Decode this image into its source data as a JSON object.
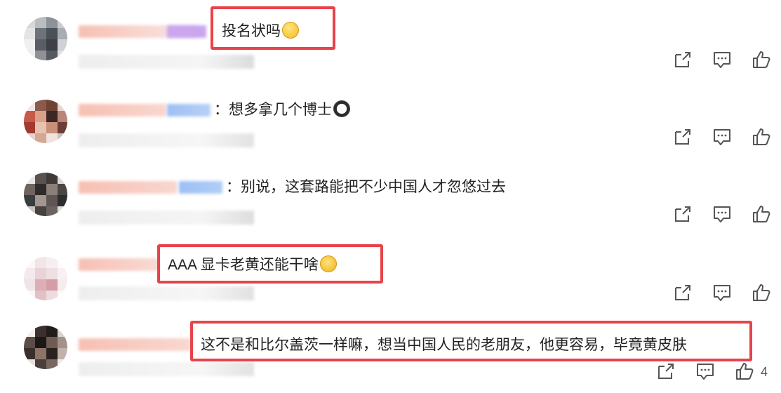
{
  "comments": [
    {
      "text": "投名状吗",
      "emoji": "smile-emoji",
      "colors": [
        "#cfd2d6",
        "#e9eaec",
        "#9aa0a6",
        "#5b5f66"
      ]
    },
    {
      "text": "：想多拿几个博士",
      "emoji": "panda-emoji",
      "colors": [
        "#c86a5d",
        "#7a4a3a",
        "#d9b4a2",
        "#3b2b29"
      ]
    },
    {
      "text": "：别说，这套路能把不少中国人才忽悠过去",
      "emoji": "",
      "colors": [
        "#4a4b4d",
        "#7c6f68",
        "#2e3133",
        "#a7a09a"
      ]
    },
    {
      "text": "AAA 显卡老黄还能干啥",
      "emoji": "thinking-emoji",
      "colors": [
        "#f4e8ea",
        "#e6d0d4",
        "#d8a9b0",
        "#ffffff"
      ]
    },
    {
      "text": "这不是和比尔盖茨一样嘛，想当中国人民的老朋友，他更容易，毕竟黄皮肤",
      "emoji": "",
      "colors": [
        "#3a2d2a",
        "#6c5a53",
        "#1e1a19",
        "#b7a49a"
      ],
      "like_count": "4"
    }
  ],
  "colors": {
    "highlight": "#e8434a",
    "icon": "#555555",
    "name_blur": "#f6c9c0",
    "tag_blur": "#9dbff5"
  }
}
